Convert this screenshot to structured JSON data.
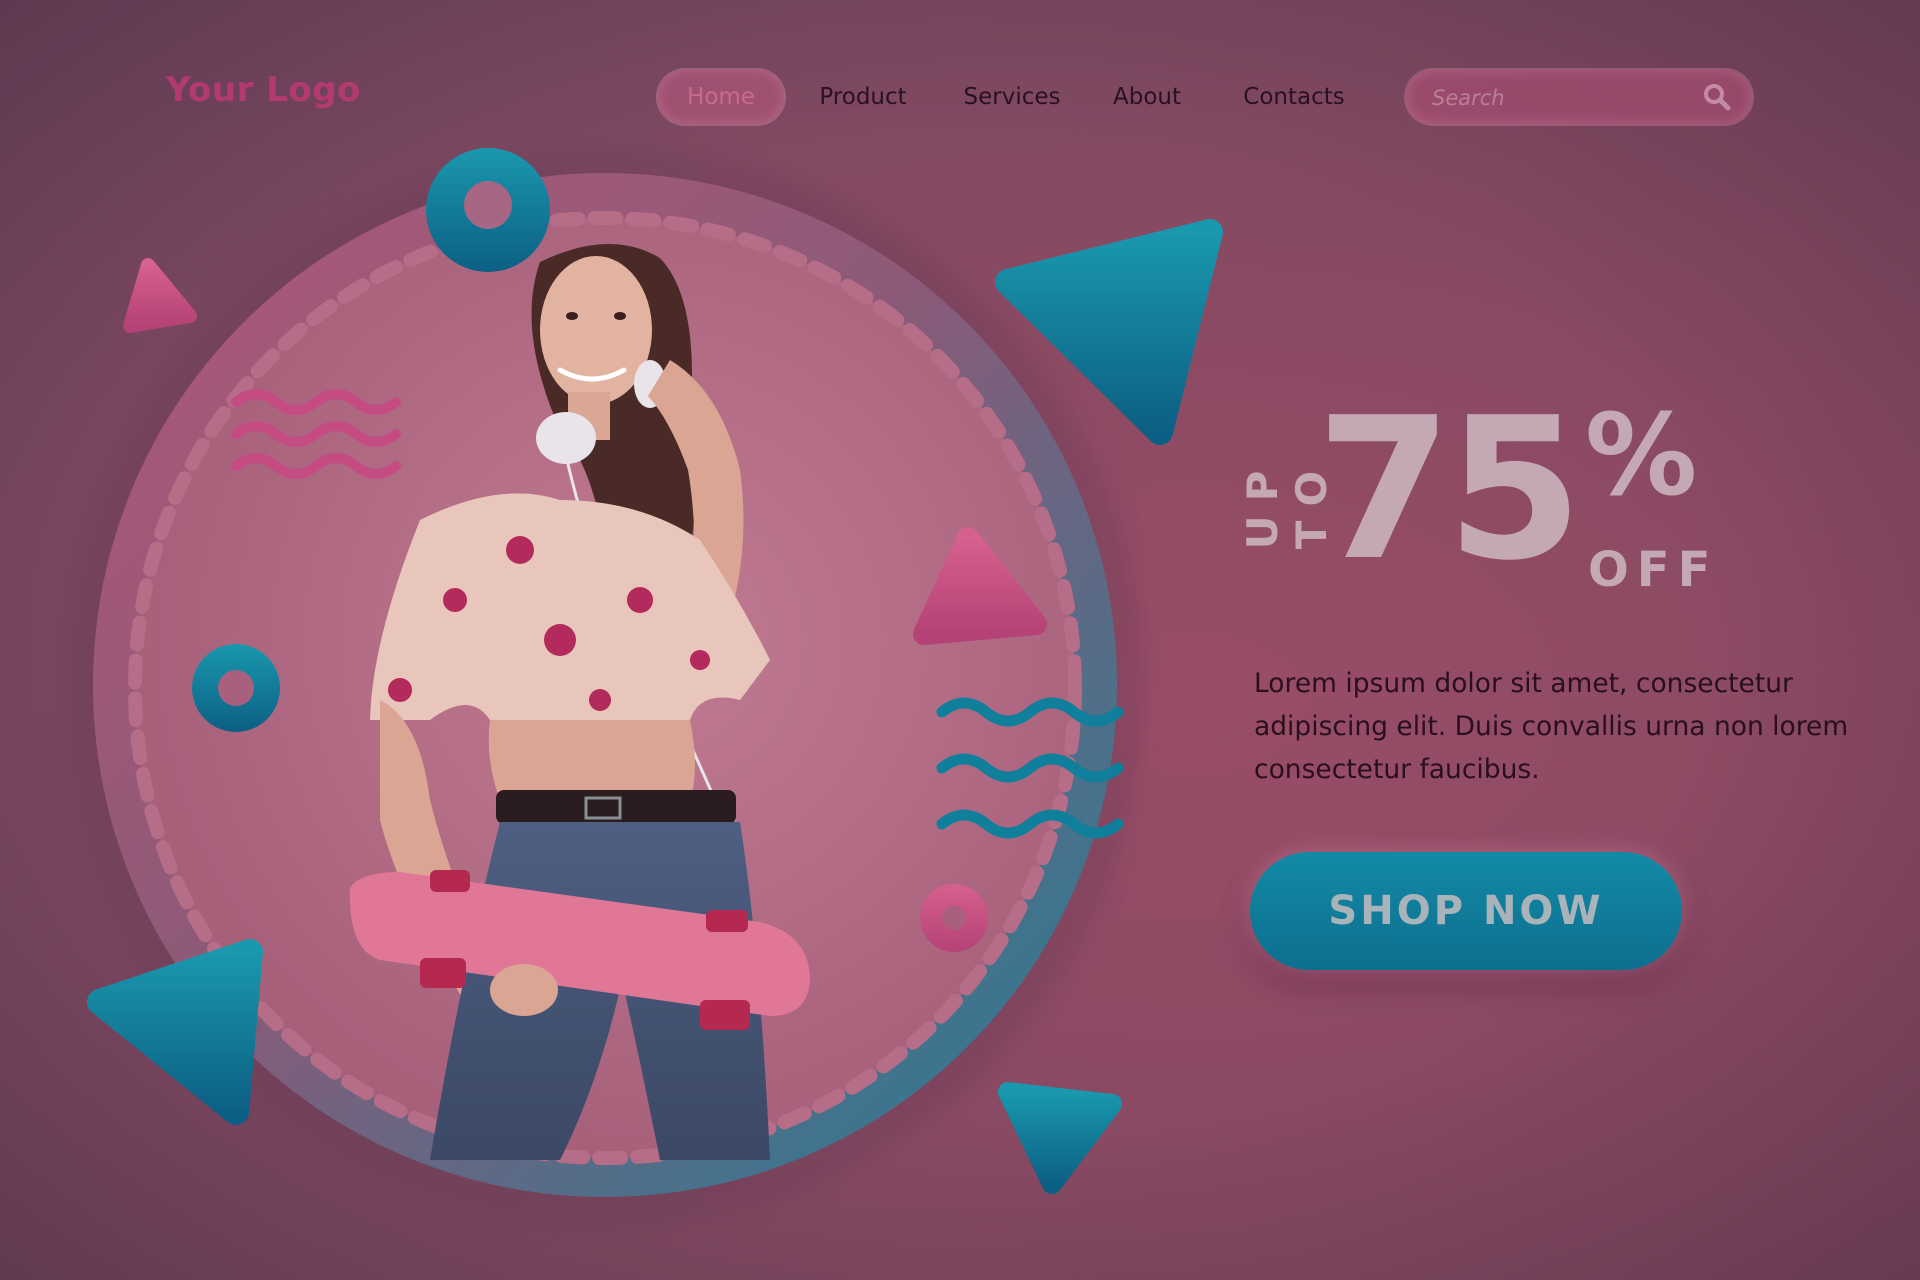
{
  "header": {
    "logo": "Your Logo",
    "nav": [
      "Home",
      "Product",
      "Services",
      "About",
      "Contacts"
    ],
    "active_nav": "Home",
    "search": {
      "placeholder": "Search",
      "icon": "search-icon"
    }
  },
  "promo": {
    "prefix": "UP TO",
    "amount": "75",
    "percent": "%",
    "suffix": "OFF",
    "description": "Lorem ipsum dolor sit amet, consectetur adipiscing elit. Duis convallis urna non lorem consectetur faucibus.",
    "cta_label": "SHOP NOW"
  },
  "colors": {
    "background": "#8a4a63",
    "brand_pink": "#b33a70",
    "accent_teal": "#0d7f9c",
    "promo_text": "#c4a9b4"
  }
}
